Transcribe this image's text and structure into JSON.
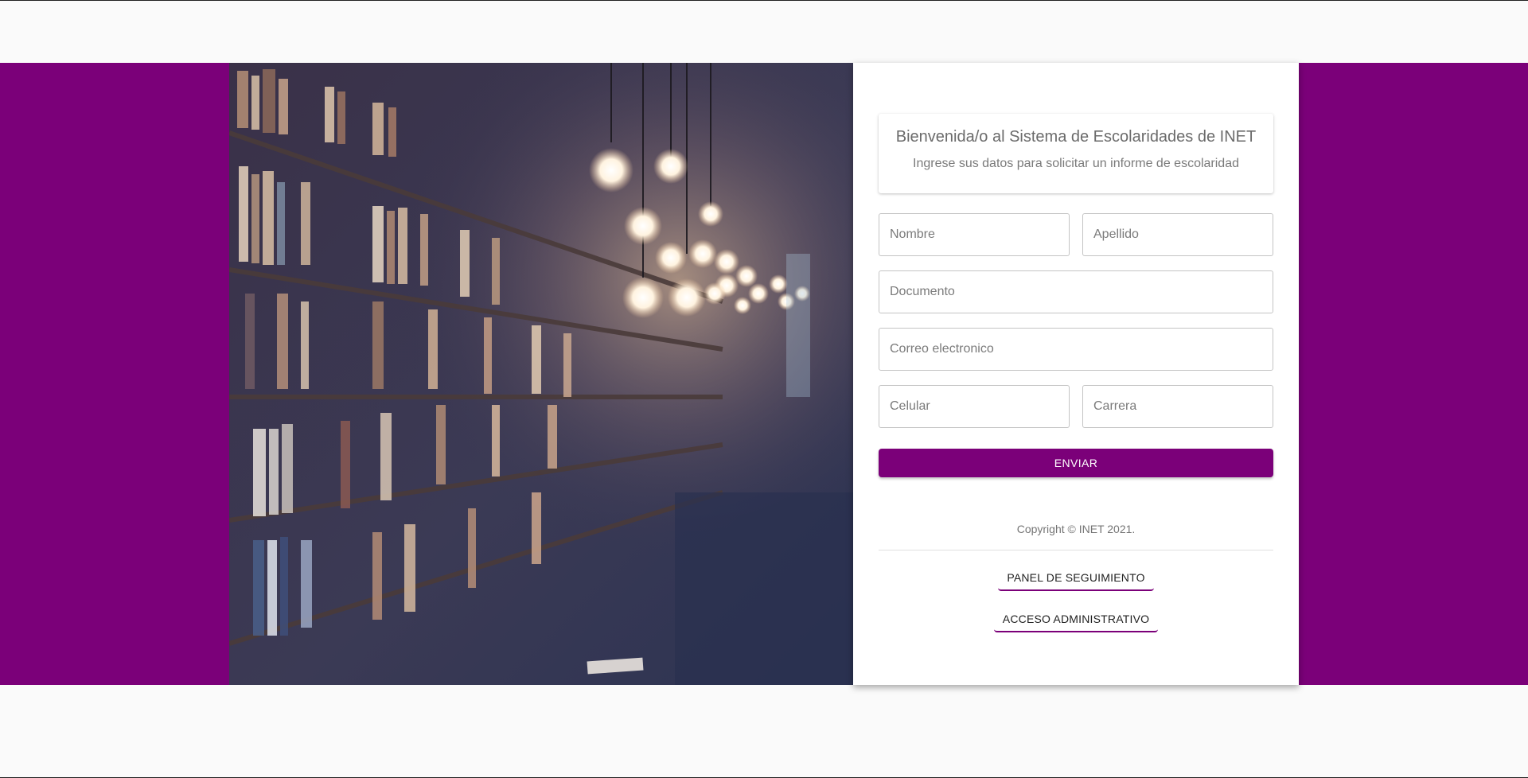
{
  "colors": {
    "accent": "#7b0079",
    "page_bg": "#fafafa",
    "card_bg": "#ffffff"
  },
  "hero": {
    "image": "library-bookshelves-with-hanging-light-bulbs"
  },
  "header": {
    "title": "Bienvenida/o al Sistema de Escolaridades de INET",
    "subtitle": "Ingrese sus datos para solicitar un informe de escolaridad"
  },
  "form": {
    "nombre": {
      "placeholder": "Nombre",
      "value": ""
    },
    "apellido": {
      "placeholder": "Apellido",
      "value": ""
    },
    "documento": {
      "placeholder": "Documento",
      "value": ""
    },
    "correo": {
      "placeholder": "Correo electronico",
      "value": ""
    },
    "celular": {
      "placeholder": "Celular",
      "value": ""
    },
    "carrera": {
      "placeholder": "Carrera",
      "value": ""
    },
    "submit_label": "ENVIAR"
  },
  "footer": {
    "copyright": "Copyright © INET 2021.",
    "panel_label": "PANEL DE SEGUIMIENTO",
    "admin_label": "ACCESO ADMINISTRATIVO"
  }
}
